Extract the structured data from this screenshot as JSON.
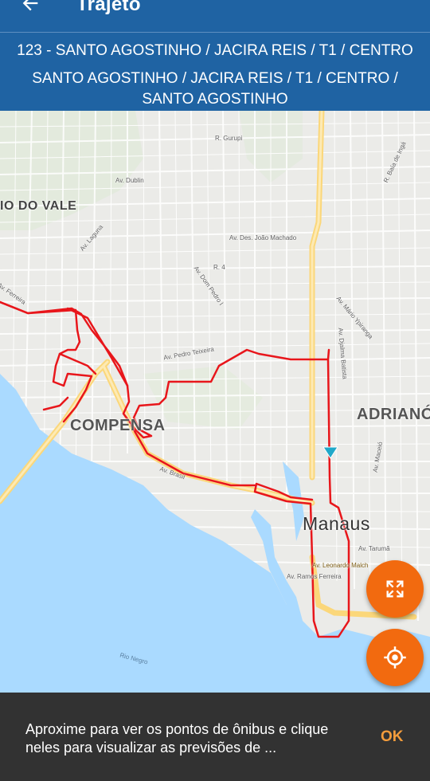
{
  "app_bar": {
    "title": "Trajeto",
    "back_icon": "arrow-left-icon"
  },
  "route": {
    "name": "123 - SANTO AGOSTINHO / JACIRA REIS / T1 / CENTRO",
    "itinerary": "SANTO AGOSTINHO / JACIRA REIS / T1 / CENTRO / SANTO AGOSTINHO"
  },
  "map": {
    "neighborhoods": {
      "rio_do_vale": "IO DO VALE",
      "compensa": "COMPENSA",
      "adrianopolis": "ADRIANÓ",
      "manaus": "Manaus"
    },
    "streets": {
      "gurupi": "R. Gurupi",
      "dublin": "Av. Dublin",
      "laguna": "Av. Laguna",
      "joao_machado": "Av. Des. João Machado",
      "r4": "R. 4",
      "dom_pedro": "Av. Dom Pedro I",
      "pedro_teixeira": "Av. Pedro Teixeira",
      "brasil": "Av. Brasil",
      "djalma": "Av. Djalma Batista",
      "mario_ypiranga": "Av. Mário Ypiranga",
      "maceio": "Av. Maceió",
      "tarumã": "Av. Tarumã",
      "leonardo": "Av. Leonardo Malch",
      "ramos": "Av. Ramos Ferreira",
      "baia": "R. Baía de Ingá",
      "ferreira": "Av. Ferreira",
      "rio_negro": "Rio Negro"
    },
    "colors": {
      "route": "#e8161b",
      "water": "#aadaff",
      "highway": "#fde293",
      "location_arrow": "#20a8c9"
    }
  },
  "fabs": {
    "fullscreen_icon": "fullscreen-icon",
    "locate_icon": "my-location-icon"
  },
  "snackbar": {
    "message": "Aproxime para ver os pontos de ônibus e clique neles para visualizar as previsões de ...",
    "action": "OK"
  }
}
